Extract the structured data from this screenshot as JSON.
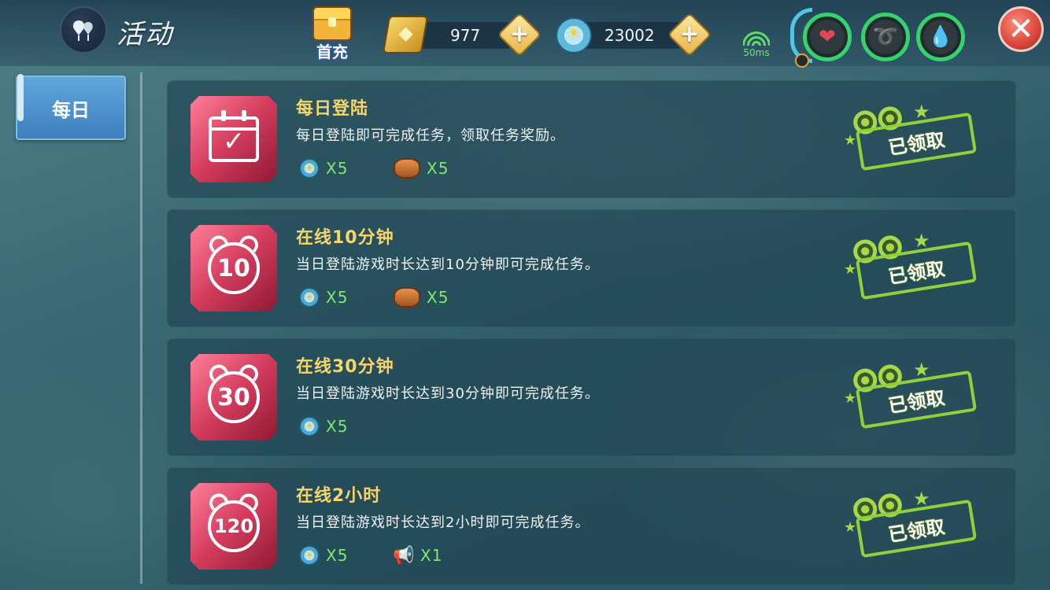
{
  "header": {
    "title": "活动",
    "first_charge_label": "首充",
    "gems": {
      "value": "977",
      "plus": "+"
    },
    "sun_coins": {
      "value": "23002",
      "plus": "+"
    },
    "ping": "50ms",
    "close": "✕"
  },
  "sidebar": {
    "tabs": [
      {
        "label": "每日"
      }
    ]
  },
  "tasks": [
    {
      "title": "每日登陆",
      "desc": "每日登陆即可完成任务，领取任务奖励。",
      "icon": "calendar-icon",
      "icon_text": "✓",
      "rewards": [
        {
          "icon": "sun-coin-icon",
          "qty": "X5"
        },
        {
          "icon": "bread-icon",
          "qty": "X5"
        }
      ],
      "status": "已领取"
    },
    {
      "title": "在线10分钟",
      "desc": "当日登陆游戏时长达到10分钟即可完成任务。",
      "icon": "alarm-clock-icon",
      "icon_text": "10",
      "rewards": [
        {
          "icon": "sun-coin-icon",
          "qty": "X5"
        },
        {
          "icon": "bread-icon",
          "qty": "X5"
        }
      ],
      "status": "已领取"
    },
    {
      "title": "在线30分钟",
      "desc": "当日登陆游戏时长达到30分钟即可完成任务。",
      "icon": "alarm-clock-icon",
      "icon_text": "30",
      "rewards": [
        {
          "icon": "sun-coin-icon",
          "qty": "X5"
        }
      ],
      "status": "已领取"
    },
    {
      "title": "在线2小时",
      "desc": "当日登陆游戏时长达到2小时即可完成任务。",
      "icon": "alarm-clock-icon",
      "icon_text": "120",
      "rewards": [
        {
          "icon": "sun-coin-icon",
          "qty": "X5"
        },
        {
          "icon": "megaphone-icon",
          "qty": "X1"
        }
      ],
      "status": "已领取"
    }
  ],
  "colors": {
    "accent_title": "#f6d66a",
    "reward_qty": "#7fe86f",
    "claimed_stamp": "#8fd13a",
    "tab_active": "#4f90cc"
  }
}
